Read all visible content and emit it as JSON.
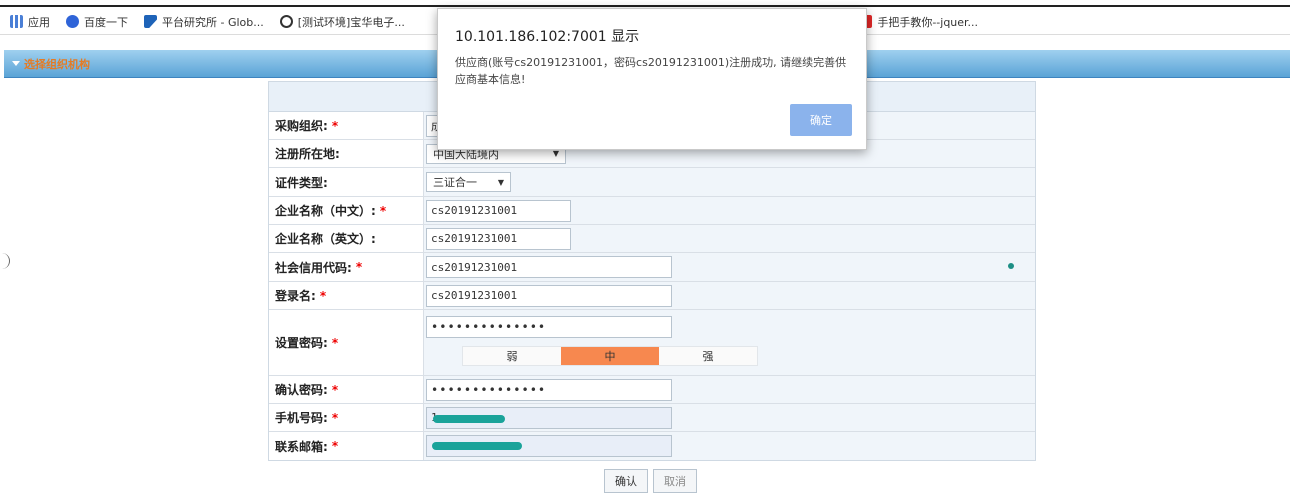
{
  "bookmarks": [
    {
      "label": "应用",
      "icon": "apps-grid-icon"
    },
    {
      "label": "百度一下",
      "icon": "baidu-paw-icon"
    },
    {
      "label": "平台研究所 - Glob...",
      "icon": "platform-logo-icon"
    },
    {
      "label": "[测试环境]宝华电子...",
      "icon": "test-env-icon"
    },
    {
      "label": "...",
      "icon": ""
    },
    {
      "label": "手把手教你--jquer...",
      "icon": "jquery-c-icon"
    }
  ],
  "header": {
    "title": "选择组织机构"
  },
  "form": {
    "rows": [
      {
        "label": "采购组织:",
        "required": true,
        "value": "成"
      },
      {
        "label": "注册所在地:",
        "required": false,
        "value": "中国大陆境内"
      },
      {
        "label": "证件类型:",
        "required": false,
        "value": "三证合一"
      },
      {
        "label": "企业名称（中文）:",
        "required": true,
        "value": "cs20191231001"
      },
      {
        "label": "企业名称（英文）:",
        "required": false,
        "value": "cs20191231001"
      },
      {
        "label": "社会信用代码:",
        "required": true,
        "value": "cs20191231001"
      },
      {
        "label": "登录名:",
        "required": true,
        "value": "cs20191231001"
      },
      {
        "label": "设置密码:",
        "required": true,
        "value": "••••••••••••••"
      },
      {
        "label": "确认密码:",
        "required": true,
        "value": "••••••••••••••"
      },
      {
        "label": "手机号码:",
        "required": true,
        "value": "1"
      },
      {
        "label": "联系邮箱:",
        "required": true,
        "value": ""
      }
    ],
    "required_mark": "*",
    "select_arrow": "▼",
    "strength": {
      "weak": "弱",
      "medium": "中",
      "strong": "强",
      "level": "medium"
    }
  },
  "buttons": {
    "confirm": "确认",
    "cancel": "取消"
  },
  "dialog": {
    "title": "10.101.186.102:7001 显示",
    "message": "供应商(账号cs20191231001，密码cs20191231001)注册成功, 请继续完善供应商基本信息!",
    "ok_label": "确定"
  },
  "colors": {
    "accent": "#8bb3ec",
    "required": "#ee0000",
    "strength_active": "#f7884f",
    "mask": "#1aa39a"
  }
}
